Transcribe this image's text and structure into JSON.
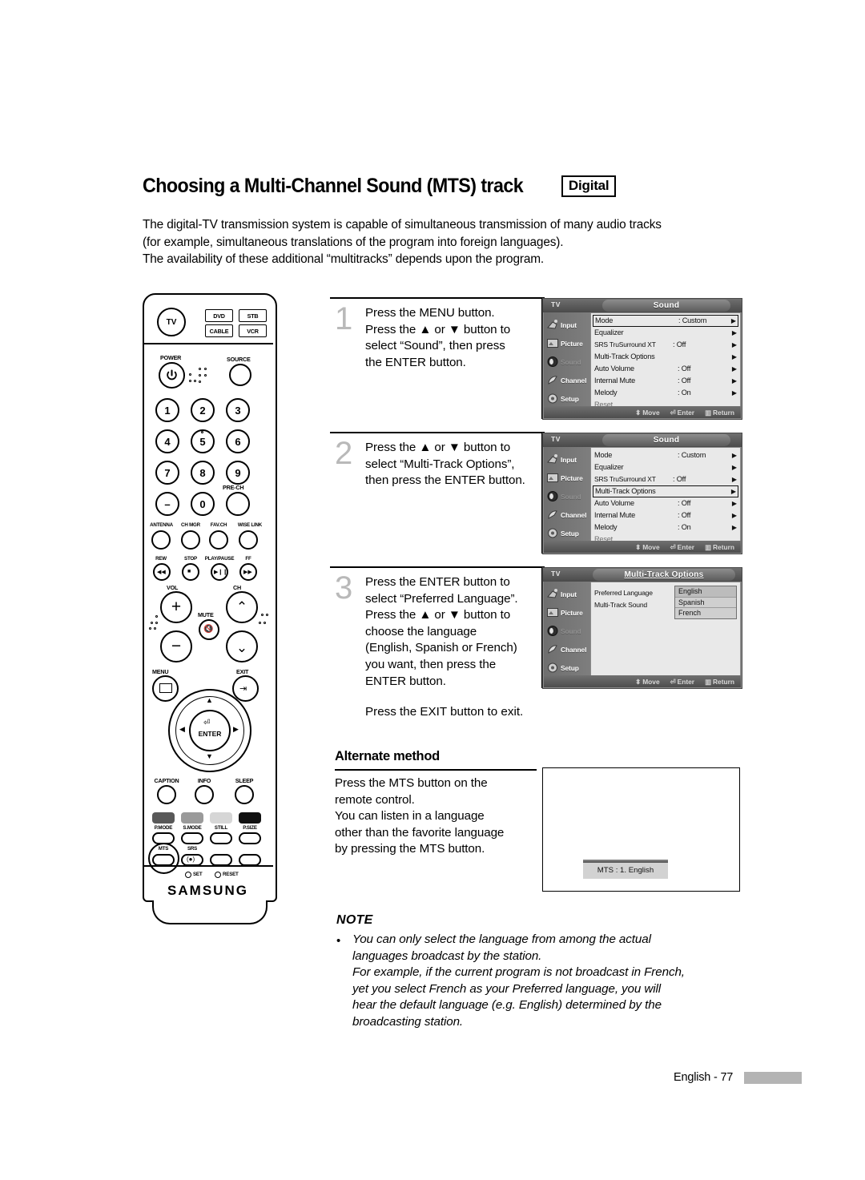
{
  "header": {
    "title": "Choosing a Multi-Channel Sound (MTS) track",
    "badge": "Digital",
    "intro_lines": [
      "The digital-TV transmission system is capable of simultaneous transmission of many audio tracks",
      "(for example, simultaneous translations of the program into foreign languages).",
      "The availability of these additional “multitracks” depends upon the program."
    ]
  },
  "remote": {
    "brand": "SAMSUNG",
    "mode_buttons": [
      "TV",
      "DVD",
      "STB",
      "CABLE",
      "VCR"
    ],
    "power_label": "POWER",
    "source_label": "SOURCE",
    "numbers": [
      "1",
      "2",
      "3",
      "4",
      "5",
      "6",
      "7",
      "8",
      "9",
      "–",
      "0"
    ],
    "prech_label": "PRE-CH",
    "row_labels": [
      "ANTENNA",
      "CH MGR",
      "FAV.CH",
      "WISE LINK"
    ],
    "transport_labels": [
      "REW",
      "STOP",
      "PLAY/PAUSE",
      "FF"
    ],
    "vol_label": "VOL",
    "ch_label": "CH",
    "mute_label": "MUTE",
    "menu_label": "MENU",
    "exit_label": "EXIT",
    "enter_label": "ENTER",
    "fn_row": [
      "CAPTION",
      "INFO",
      "SLEEP"
    ],
    "mode_row": [
      "P.MODE",
      "S.MODE",
      "STILL",
      "P.SIZE"
    ],
    "bottom_row": [
      "MTS",
      "SRS"
    ],
    "set_label": "SET",
    "reset_label": "RESET"
  },
  "steps": [
    {
      "number": "1",
      "lines": [
        "Press the MENU button.",
        "Press the ▲ or ▼ button to",
        "select “Sound”, then press",
        "the ENTER button."
      ]
    },
    {
      "number": "2",
      "lines": [
        "Press the ▲ or ▼ button to",
        "select “Multi-Track Options”,",
        "then press the ENTER button."
      ]
    },
    {
      "number": "3",
      "lines": [
        "Press the ENTER button to",
        "select “Preferred Language”.",
        "Press the ▲ or ▼ button to",
        "choose the language",
        "(English, Spanish or French)",
        "you want, then press the",
        "ENTER button."
      ],
      "extra": "Press the EXIT button to exit."
    }
  ],
  "osd": {
    "tv_label": "TV",
    "sidebar": [
      "Input",
      "Picture",
      "Sound",
      "Channel",
      "Setup"
    ],
    "footer": {
      "move": "Move",
      "enter": "Enter",
      "return": "Return"
    },
    "menu1": {
      "title": "Sound",
      "rows": [
        {
          "key": "Mode",
          "value": ": Custom",
          "arrow": "▶",
          "selected": true
        },
        {
          "key": "Equalizer",
          "value": "",
          "arrow": "▶"
        },
        {
          "key": "SRS TruSurround XT",
          "value": ": Off",
          "arrow": "▶"
        },
        {
          "key": "Multi-Track Options",
          "value": "",
          "arrow": "▶"
        },
        {
          "key": "Auto Volume",
          "value": ": Off",
          "arrow": "▶"
        },
        {
          "key": "Internal Mute",
          "value": ": Off",
          "arrow": "▶"
        },
        {
          "key": "Melody",
          "value": ": On",
          "arrow": "▶"
        },
        {
          "key": "Reset",
          "value": "",
          "arrow": "",
          "dim": true
        }
      ]
    },
    "menu2": {
      "title": "Sound",
      "rows": [
        {
          "key": "Mode",
          "value": ": Custom",
          "arrow": "▶"
        },
        {
          "key": "Equalizer",
          "value": "",
          "arrow": "▶"
        },
        {
          "key": "SRS TruSurround XT",
          "value": ": Off",
          "arrow": "▶"
        },
        {
          "key": "Multi-Track Options",
          "value": "",
          "arrow": "▶",
          "selected": true
        },
        {
          "key": "Auto Volume",
          "value": ": Off",
          "arrow": "▶"
        },
        {
          "key": "Internal Mute",
          "value": ": Off",
          "arrow": "▶"
        },
        {
          "key": "Melody",
          "value": ": On",
          "arrow": "▶"
        },
        {
          "key": "Reset",
          "value": "",
          "arrow": "",
          "dim": true
        }
      ]
    },
    "menu3": {
      "title": "Multi-Track Options",
      "rows": [
        {
          "key": "Preferred Language",
          "value": "",
          "arrow": ""
        },
        {
          "key": "Multi-Track Sound",
          "value": "",
          "arrow": ""
        }
      ],
      "languages": [
        "English",
        "Spanish",
        "French"
      ],
      "highlighted_language": "English"
    }
  },
  "alternate": {
    "title": "Alternate method",
    "lines": [
      "Press the MTS button on the",
      "remote control.",
      "You can listen in a language",
      "other than the favorite language",
      "by pressing the MTS button."
    ],
    "osd_message": "MTS : 1. English"
  },
  "note": {
    "title": "NOTE",
    "bullet": "•",
    "lines": [
      "You can only select the language from among the actual",
      "languages broadcast by the station.",
      "For example, if the current program is not broadcast in French,",
      "yet you select French as your Preferred language, you will",
      "hear the default language (e.g. English) determined by the",
      "broadcasting station."
    ]
  },
  "footer": {
    "text": "English - 77"
  },
  "colors": {
    "text": "#000000",
    "step_number": "#b9b9b9",
    "osd_panel": "#e9e9e9",
    "osd_chrome": "#6e6e6e",
    "footer_bar": "#b4b4b4"
  }
}
